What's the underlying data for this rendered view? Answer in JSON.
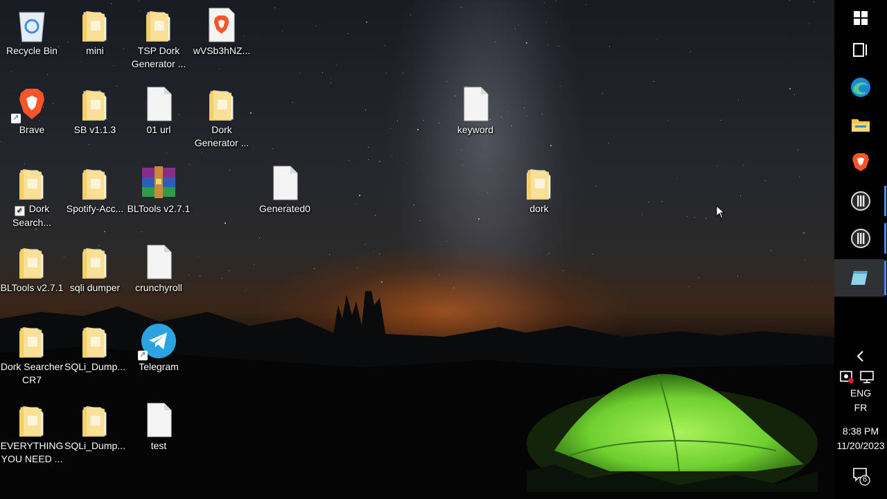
{
  "desktop": {
    "icons": [
      {
        "label": "Recycle Bin",
        "icon": "recycle-bin-icon"
      },
      {
        "label": "mini",
        "icon": "folder-icon"
      },
      {
        "label": "TSP Dork Generator ...",
        "icon": "folder-icon"
      },
      {
        "label": "wVSb3hNZ...",
        "icon": "brave-file-icon"
      },
      {
        "label": "Brave",
        "icon": "brave-icon"
      },
      {
        "label": "SB v1.1.3",
        "icon": "folder-icon"
      },
      {
        "label": "01 url",
        "icon": "text-file-icon"
      },
      {
        "label": "Dork Generator ...",
        "icon": "folder-icon"
      },
      {
        "label": "keyword",
        "icon": "text-file-icon"
      },
      {
        "label": "Dork Search...",
        "icon": "folder-icon"
      },
      {
        "label": "Spotify-Acc...",
        "icon": "folder-icon"
      },
      {
        "label": "BLTools v2.7.1",
        "icon": "winrar-icon"
      },
      {
        "label": "Generated0",
        "icon": "text-file-icon"
      },
      {
        "label": "dork",
        "icon": "folder-icon"
      },
      {
        "label": "BLTools v2.7.1",
        "icon": "folder-icon"
      },
      {
        "label": "sqli dumper",
        "icon": "folder-icon"
      },
      {
        "label": "crunchyroll",
        "icon": "text-file-icon"
      },
      {
        "label": "Dork Searcher CR7",
        "icon": "folder-icon"
      },
      {
        "label": "SQLi_Dump...",
        "icon": "folder-icon"
      },
      {
        "label": "Telegram",
        "icon": "telegram-icon"
      },
      {
        "label": "EVERYTHING YOU NEED ...",
        "icon": "folder-icon"
      },
      {
        "label": "SQLi_Dump...",
        "icon": "folder-icon"
      },
      {
        "label": "test",
        "icon": "text-file-icon"
      }
    ]
  },
  "taskbar": {
    "start_icon": "windows-icon",
    "task_view_icon": "task-view-icon",
    "apps": [
      "edge-icon",
      "file-explorer-icon",
      "brave-icon",
      "app-icon",
      "app-icon",
      "notepad-icon"
    ],
    "tray": {
      "chevron": "chevron-left-icon",
      "language_primary": "ENG",
      "language_secondary": "FR",
      "time": "8:38 PM",
      "date": "11/20/2023",
      "notification_count": "6"
    }
  },
  "colors": {
    "folder_yellow": "#f3cf6a",
    "brave_orange": "#fb542b",
    "telegram_blue": "#2aa3e0",
    "tent_green": "#7ee33a",
    "taskbar_bg": "#000000",
    "running_indicator": "#4a8cff"
  }
}
